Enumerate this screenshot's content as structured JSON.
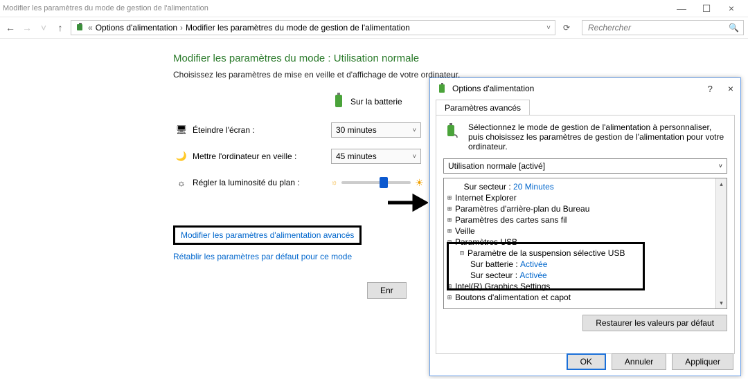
{
  "window": {
    "title": "Modifier les paramètres du mode de gestion de l'alimentation",
    "win_minimize": "—",
    "win_maximize": "☐",
    "win_close": "×"
  },
  "nav": {
    "back": "←",
    "forward": "→",
    "recent": "˅",
    "up": "↑",
    "breadcrumb1": "Options d'alimentation",
    "breadcrumb2": "Modifier les paramètres du mode de gestion de l'alimentation",
    "sep": "›",
    "refresh": "⟳",
    "search_placeholder": "Rechercher"
  },
  "page": {
    "heading": "Modifier les paramètres du mode : Utilisation normale",
    "sub": "Choisissez les paramètres de mise en veille et d'affichage de votre ordinateur.",
    "battery_label": "Sur la batterie",
    "r1_label": "Éteindre l'écran :",
    "r1_value": "30 minutes",
    "r2_label": "Mettre l'ordinateur en veille :",
    "r2_value": "45 minutes",
    "r3_label": "Régler la luminosité du plan :",
    "adv_link": "Modifier les paramètres d'alimentation avancés",
    "restore_link": "Rétablir les paramètres par défaut pour ce mode",
    "save_btn": "Enr"
  },
  "dialog": {
    "title": "Options d'alimentation",
    "help": "?",
    "close": "×",
    "tab": "Paramètres avancés",
    "tip": "Sélectionnez le mode de gestion de l'alimentation à personnaliser, puis choisissez les paramètres de gestion de l'alimentation pour votre ordinateur.",
    "plan": "Utilisation normale [activé]",
    "tree": {
      "top_label": "Sur secteur :",
      "top_value": "20 Minutes",
      "n1": "Internet Explorer",
      "n2": "Paramètres d'arrière-plan du Bureau",
      "n3": "Paramètres des cartes sans fil",
      "n4": "Veille",
      "n5": "Paramètres USB",
      "n5a": "Paramètre de la suspension sélective USB",
      "n5a1_k": "Sur batterie :",
      "n5a1_v": "Activée",
      "n5a2_k": "Sur secteur :",
      "n5a2_v": "Activée",
      "n6": "Intel(R) Graphics Settings",
      "n7": "Boutons d'alimentation et capot"
    },
    "restore_btn": "Restaurer les valeurs par défaut",
    "ok": "OK",
    "cancel": "Annuler",
    "apply": "Appliquer"
  }
}
